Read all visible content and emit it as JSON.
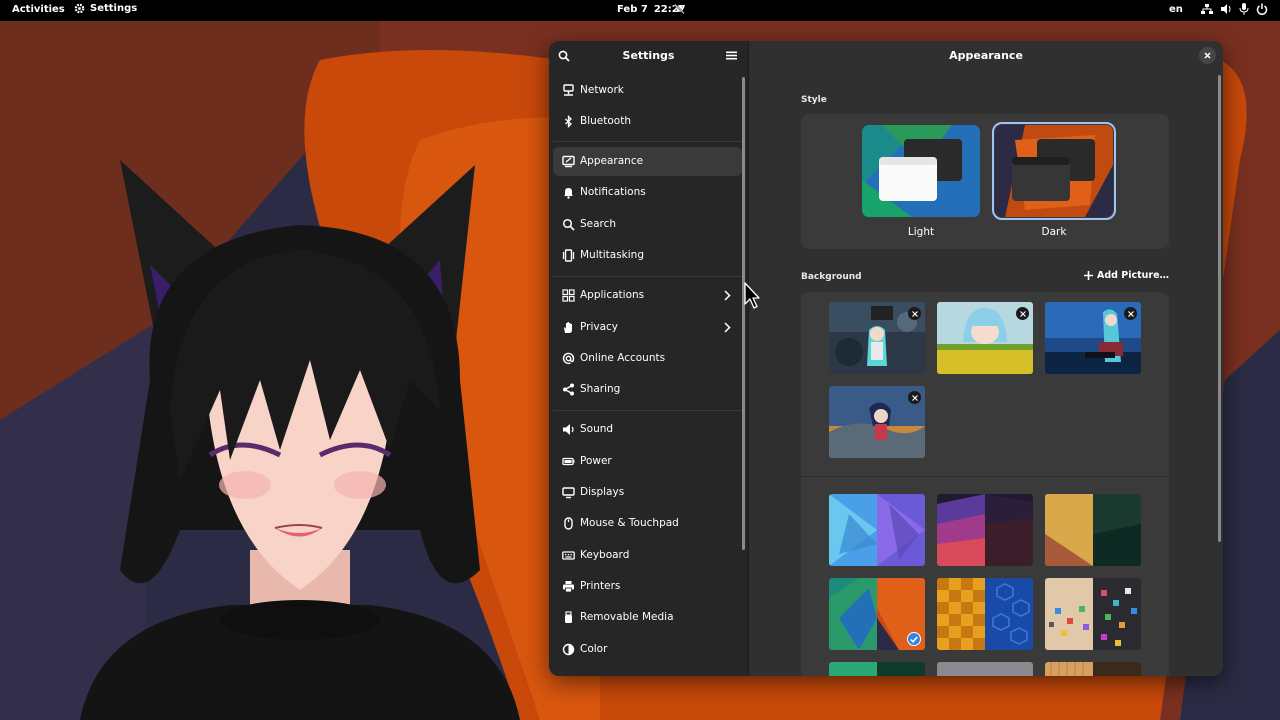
{
  "topbar": {
    "activities": "Activities",
    "app_name": "Settings",
    "date": "Feb 7",
    "time": "22:27",
    "lang": "en"
  },
  "sidebar": {
    "title": "Settings",
    "items": [
      {
        "label": "Network",
        "icon": "network-icon"
      },
      {
        "label": "Bluetooth",
        "icon": "bluetooth-icon"
      },
      {
        "label": "Appearance",
        "icon": "appearance-icon",
        "active": true
      },
      {
        "label": "Notifications",
        "icon": "bell-icon"
      },
      {
        "label": "Search",
        "icon": "search-icon"
      },
      {
        "label": "Multitasking",
        "icon": "multitasking-icon"
      },
      {
        "label": "Applications",
        "icon": "grid-icon",
        "chevron": true
      },
      {
        "label": "Privacy",
        "icon": "hand-icon",
        "chevron": true
      },
      {
        "label": "Online Accounts",
        "icon": "at-icon"
      },
      {
        "label": "Sharing",
        "icon": "share-icon"
      },
      {
        "label": "Sound",
        "icon": "speaker-icon"
      },
      {
        "label": "Power",
        "icon": "battery-icon"
      },
      {
        "label": "Displays",
        "icon": "display-icon"
      },
      {
        "label": "Mouse & Touchpad",
        "icon": "mouse-icon"
      },
      {
        "label": "Keyboard",
        "icon": "keyboard-icon"
      },
      {
        "label": "Printers",
        "icon": "printer-icon"
      },
      {
        "label": "Removable Media",
        "icon": "usb-icon"
      },
      {
        "label": "Color",
        "icon": "color-icon"
      }
    ]
  },
  "content": {
    "title": "Appearance",
    "style_label": "Style",
    "style_options": [
      "Light",
      "Dark"
    ],
    "selected_style": "Dark",
    "background_label": "Background",
    "add_picture": "Add Picture…"
  },
  "colors": {
    "accent": "#3584e4",
    "window_bg": "#303030",
    "sidebar_bg": "#262626",
    "wallpaper_orange": "#c8490a"
  }
}
